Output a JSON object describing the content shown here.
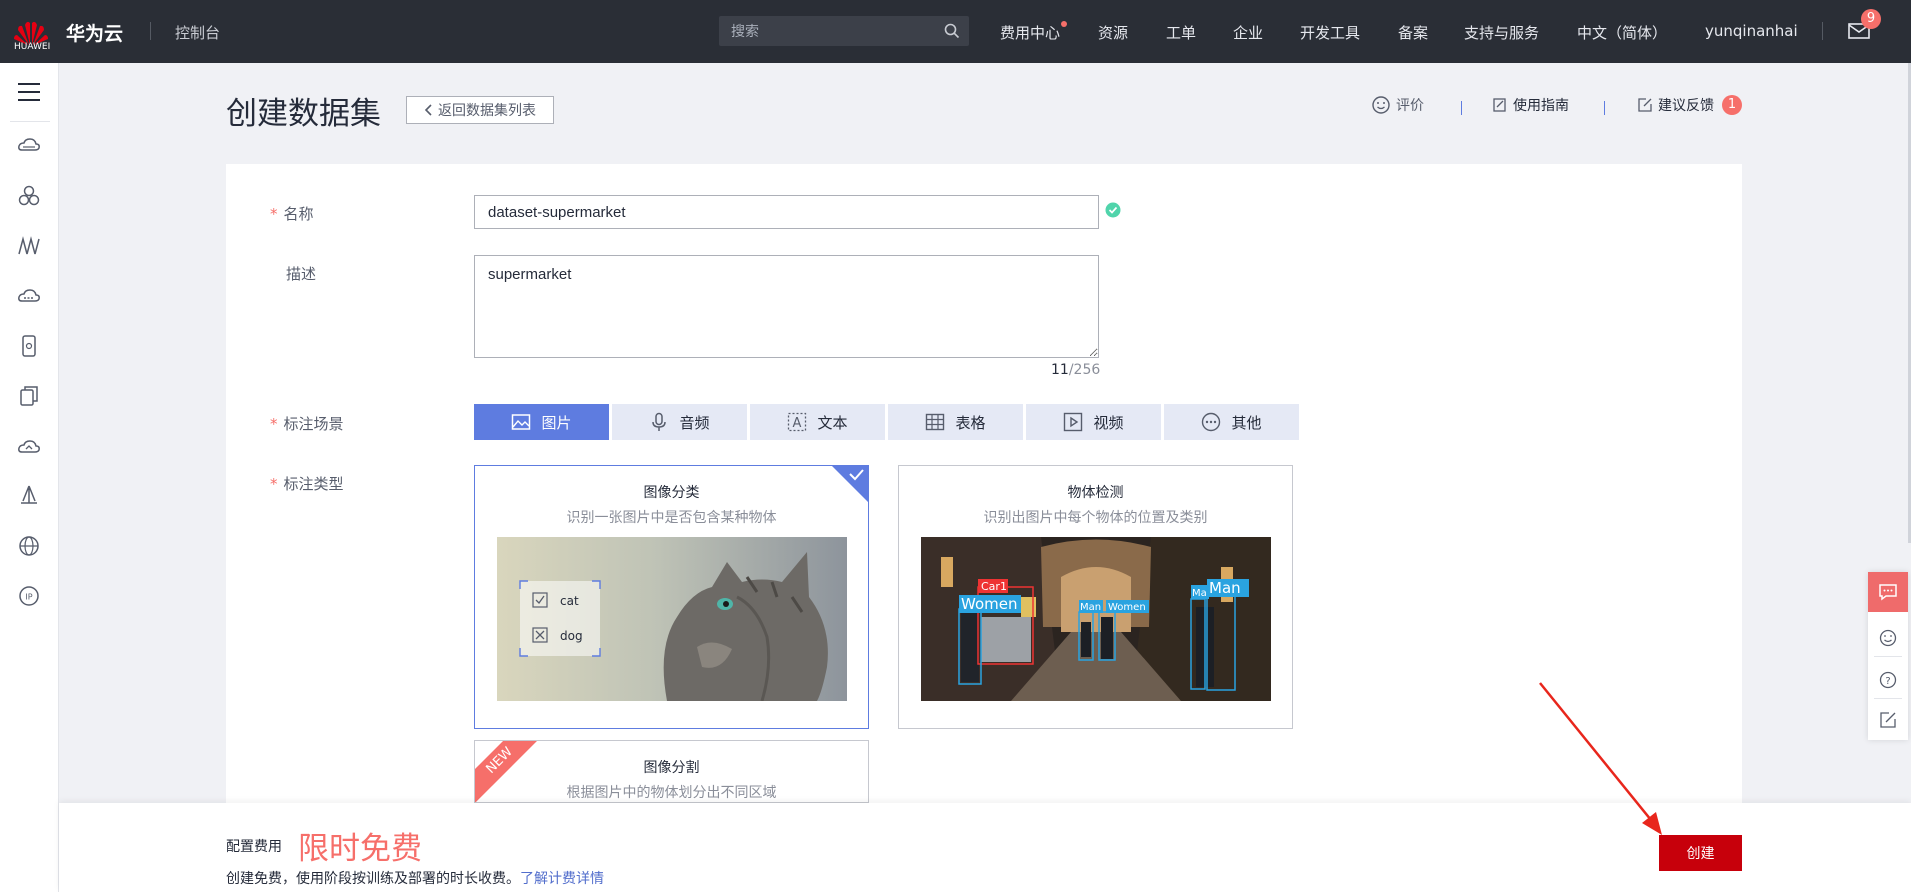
{
  "topbar": {
    "logo_word": "HUAWEI",
    "brand": "华为云",
    "console": "控制台",
    "search_placeholder": "搜索",
    "nav": [
      "费用中心",
      "资源",
      "工单",
      "企业",
      "开发工具",
      "备案",
      "支持与服务",
      "中文（简体）",
      "yunqinanhai"
    ],
    "mail_count": "9"
  },
  "header": {
    "title": "创建数据集",
    "back_label": "返回数据集列表",
    "rate_label": "评价",
    "guide_label": "使用指南",
    "feedback_label": "建议反馈",
    "feedback_count": "1"
  },
  "form": {
    "name_label": "名称",
    "name_value": "dataset-supermarket",
    "desc_label": "描述",
    "desc_value": "supermarket",
    "desc_count": "11",
    "desc_max": "/256",
    "scene_label": "标注场景",
    "scenes": [
      "图片",
      "音频",
      "文本",
      "表格",
      "视频",
      "其他"
    ],
    "type_label": "标注类型",
    "types": [
      {
        "title": "图像分类",
        "subtitle": "识别一张图片中是否包含某种物体",
        "labels": [
          "cat",
          "dog"
        ]
      },
      {
        "title": "物体检测",
        "subtitle": "识别出图片中每个物体的位置及类别",
        "labels": [
          "Car1",
          "Women",
          "Man",
          "Women",
          "Ma",
          "Man"
        ]
      },
      {
        "title": "图像分割",
        "subtitle": "根据图片中的物体划分出不同区域",
        "ribbon": "NEW"
      }
    ]
  },
  "footer": {
    "fee_label": "配置费用",
    "fee_value": "限时免费",
    "fee_note": "创建免费，使用阶段按训练及部署的时长收费。",
    "fee_link": "了解计费详情",
    "create_label": "创建"
  },
  "colors": {
    "accent": "#5e7ce0",
    "danger": "#c7000b",
    "highlight": "#f66f6a",
    "topbar": "#2a2e36"
  },
  "icons": {
    "rail": [
      "menu-icon",
      "cloud-server-icon",
      "cluster-icon",
      "function-icon",
      "disk-icon",
      "mobile-icon",
      "copy-icon",
      "cloud-icon",
      "deploy-icon",
      "globe-icon",
      "ip-icon"
    ],
    "floating": [
      "chat-icon",
      "smile-icon",
      "help-icon",
      "edit-icon"
    ]
  }
}
